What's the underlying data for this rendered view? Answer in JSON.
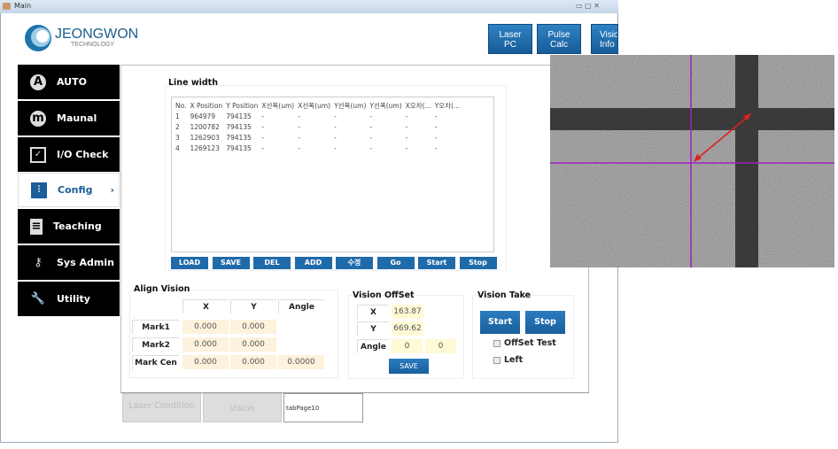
{
  "window": {
    "title": "Main"
  },
  "header": {
    "logo_main": "JEONGWON",
    "logo_sub": "TECHNOLOGY",
    "buttons": [
      {
        "label1": "Laser",
        "label2": "PC"
      },
      {
        "label1": "Pulse",
        "label2": "Calc"
      },
      {
        "label1": "Visio",
        "label2": "Info"
      }
    ]
  },
  "sidebar": {
    "items": [
      {
        "label": "AUTO",
        "icon": "auto-icon"
      },
      {
        "label": "Maunal",
        "icon": "manual-icon"
      },
      {
        "label": "I/O Check",
        "icon": "checkbox-icon"
      },
      {
        "label": "Config",
        "icon": "sliders-icon",
        "selected": true
      },
      {
        "label": "Teaching",
        "icon": "document-icon"
      },
      {
        "label": "Sys Admin",
        "icon": "key-icon"
      },
      {
        "label": "Utility",
        "icon": "wrench-icon"
      }
    ],
    "selected_chevron": "›"
  },
  "line_width": {
    "title": "Line width",
    "columns": [
      "No.",
      "X Position",
      "Y Position",
      "X선폭(um)",
      "X선폭(um)",
      "Y선폭(um)",
      "Y선폭(um)",
      "X오차(...",
      "Y오차(..."
    ],
    "rows": [
      [
        "1",
        "964979",
        "794135",
        "-",
        "-",
        "-",
        "-",
        "-",
        "-"
      ],
      [
        "2",
        "1200782",
        "794135",
        "-",
        "-",
        "-",
        "-",
        "-",
        "-"
      ],
      [
        "3",
        "1262903",
        "794135",
        "-",
        "-",
        "-",
        "-",
        "-",
        "-"
      ],
      [
        "4",
        "1269123",
        "794135",
        "-",
        "-",
        "-",
        "-",
        "-",
        "-"
      ]
    ],
    "buttons": [
      "LOAD",
      "SAVE",
      "DEL",
      "ADD",
      "수정",
      "Go",
      "Start",
      "Stop"
    ]
  },
  "align_vision": {
    "title": "Align Vision",
    "headers": [
      "X",
      "Y",
      "Angle"
    ],
    "rows": [
      {
        "label": "Mark1",
        "x": "0.000",
        "y": "0.000"
      },
      {
        "label": "Mark2",
        "x": "0.000",
        "y": "0.000"
      },
      {
        "label": "Mark Cen",
        "x": "0.000",
        "y": "0.000",
        "angle": "0.0000"
      }
    ]
  },
  "vision_offset": {
    "title": "Vision OffSet",
    "x_label": "X",
    "x": "163.87",
    "y_label": "Y",
    "y": "669.62",
    "angle_label": "Angle",
    "angle1": "0",
    "angle2": "0",
    "save": "SAVE"
  },
  "vision_take": {
    "title": "Vision Take",
    "start": "Start",
    "stop": "Stop",
    "offset_test": "OffSet Test",
    "offset_test_checked": false,
    "left": "Left",
    "left_checked": false
  },
  "tabs": [
    {
      "label": "Laser Condition"
    },
    {
      "label": "Vision"
    },
    {
      "label": "tabPage10",
      "active": true
    }
  ],
  "colors": {
    "accent": "#1f6aa8",
    "crosshair": "#a020c0",
    "arrow": "#e02020"
  }
}
